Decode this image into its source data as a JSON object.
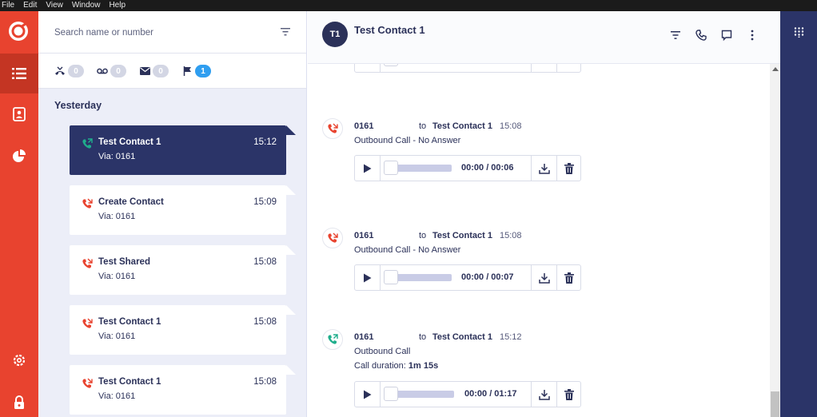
{
  "menu": [
    "File",
    "Edit",
    "View",
    "Window",
    "Help"
  ],
  "search": {
    "placeholder": "Search name or number"
  },
  "counts": {
    "missed": "0",
    "voicemail": "0",
    "messages": "0",
    "flagged": "1"
  },
  "section_title": "Yesterday",
  "contacts": [
    {
      "name": "Test Contact 1",
      "time": "15:12",
      "via": "Via: 0161",
      "type": "outbound"
    },
    {
      "name": "Create Contact",
      "time": "15:09",
      "via": "Via: 0161",
      "type": "missed"
    },
    {
      "name": "Test Shared",
      "time": "15:08",
      "via": "Via: 0161",
      "type": "missed"
    },
    {
      "name": "Test Contact 1",
      "time": "15:08",
      "via": "Via: 0161",
      "type": "missed"
    },
    {
      "name": "Test Contact 1",
      "time": "15:08",
      "via": "Via: 0161",
      "type": "missed"
    }
  ],
  "conversation": {
    "avatar": "T1",
    "title": "Test Contact 1",
    "messages": [
      {
        "from": "0161",
        "to_label": "to",
        "contact": "Test Contact 1",
        "time": "15:08",
        "status": "Outbound Call - No Answer",
        "player_time": "00:00 / 00:06"
      },
      {
        "from": "0161",
        "to_label": "to",
        "contact": "Test Contact 1",
        "time": "15:08",
        "status": "Outbound Call - No Answer",
        "player_time": "00:00 / 00:07"
      },
      {
        "from": "0161",
        "to_label": "to",
        "contact": "Test Contact 1",
        "time": "15:12",
        "status": "Outbound Call",
        "duration_label": "Call duration:",
        "duration_value": "1m 15s",
        "player_time": "00:00 / 01:17"
      }
    ]
  },
  "colors": {
    "red_rail": "#e8432f",
    "navy": "#2b3468",
    "list_bg": "#eceef8",
    "badge_blue": "#2f9ef0",
    "call_red": "#e8432f",
    "call_green": "#1fae8c"
  }
}
